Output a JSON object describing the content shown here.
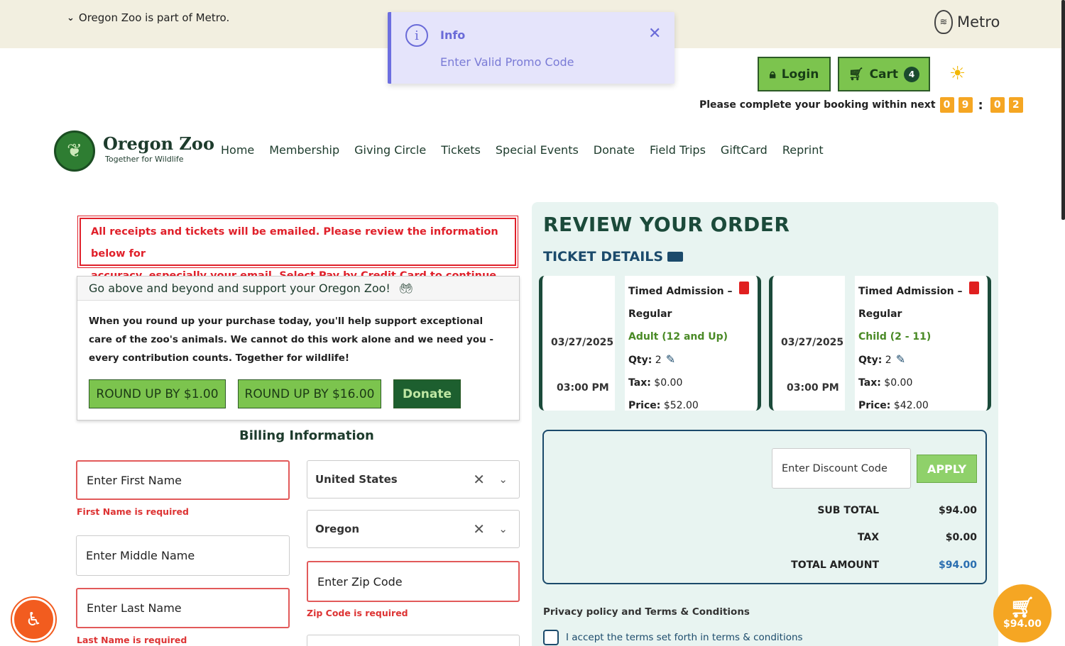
{
  "topbar": {
    "notice": "Oregon Zoo is part of Metro.",
    "metro_label": "Metro"
  },
  "toast": {
    "title": "Info",
    "message": "Enter Valid Promo Code"
  },
  "header": {
    "login_label": "Login",
    "cart_label": "Cart",
    "cart_count": "4",
    "timer_text": "Please complete your booking within next",
    "timer_digits": [
      "0",
      "9",
      "0",
      "2"
    ]
  },
  "brand": {
    "name": "Oregon Zoo",
    "tagline": "Together for Wildlife"
  },
  "nav": [
    "Home",
    "Membership",
    "Giving Circle",
    "Tickets",
    "Special Events",
    "Donate",
    "Field Trips",
    "GiftCard",
    "Reprint"
  ],
  "notice": {
    "line1": "All receipts and tickets will be emailed. Please review the information below for",
    "line2": "accuracy, especially your email. Select Pay by Credit Card to continue."
  },
  "donate": {
    "heading": "Go above and beyond and support your Oregon Zoo!",
    "body": "When you round up your purchase today, you'll help support exceptional care of the zoo's animals. We cannot do this work alone and we need you - every contribution counts. Together for wildlife!",
    "round1": "ROUND UP BY $1.00",
    "round2": "ROUND UP BY $16.00",
    "donate_label": "Donate"
  },
  "billing": {
    "title": "Billing Information",
    "first_name": "Enter First Name",
    "first_name_err": "First Name is required",
    "middle_name": "Enter Middle Name",
    "last_name": "Enter Last Name",
    "last_name_err": "Last Name is required",
    "country": "United States",
    "state": "Oregon",
    "zip": "Enter Zip Code",
    "zip_err": "Zip Code is required"
  },
  "review": {
    "title": "REVIEW YOUR ORDER",
    "ticket_details": "TICKET DETAILS",
    "tickets": [
      {
        "date": "03/27/2025",
        "time": "03:00 PM",
        "name1": "Timed Admission –",
        "name2": "Regular",
        "type": "Adult (12 and Up)",
        "qty_label": "Qty:",
        "qty": "2",
        "tax_label": "Tax:",
        "tax": "$0.00",
        "price_label": "Price:",
        "price": "$52.00"
      },
      {
        "date": "03/27/2025",
        "time": "03:00 PM",
        "name1": "Timed Admission –",
        "name2": "Regular",
        "type": "Child (2 - 11)",
        "qty_label": "Qty:",
        "qty": "2",
        "tax_label": "Tax:",
        "tax": "$0.00",
        "price_label": "Price:",
        "price": "$42.00"
      }
    ],
    "discount_placeholder": "Enter Discount Code",
    "apply_label": "APPLY",
    "sub_total_label": "SUB TOTAL",
    "sub_total": "$94.00",
    "tax_label": "TAX",
    "tax": "$0.00",
    "total_label": "TOTAL AMOUNT",
    "total": "$94.00",
    "privacy": "Privacy policy and Terms & Conditions",
    "accept": "I accept the terms set forth in terms & conditions"
  },
  "float_cart": {
    "amount": "$94.00"
  }
}
